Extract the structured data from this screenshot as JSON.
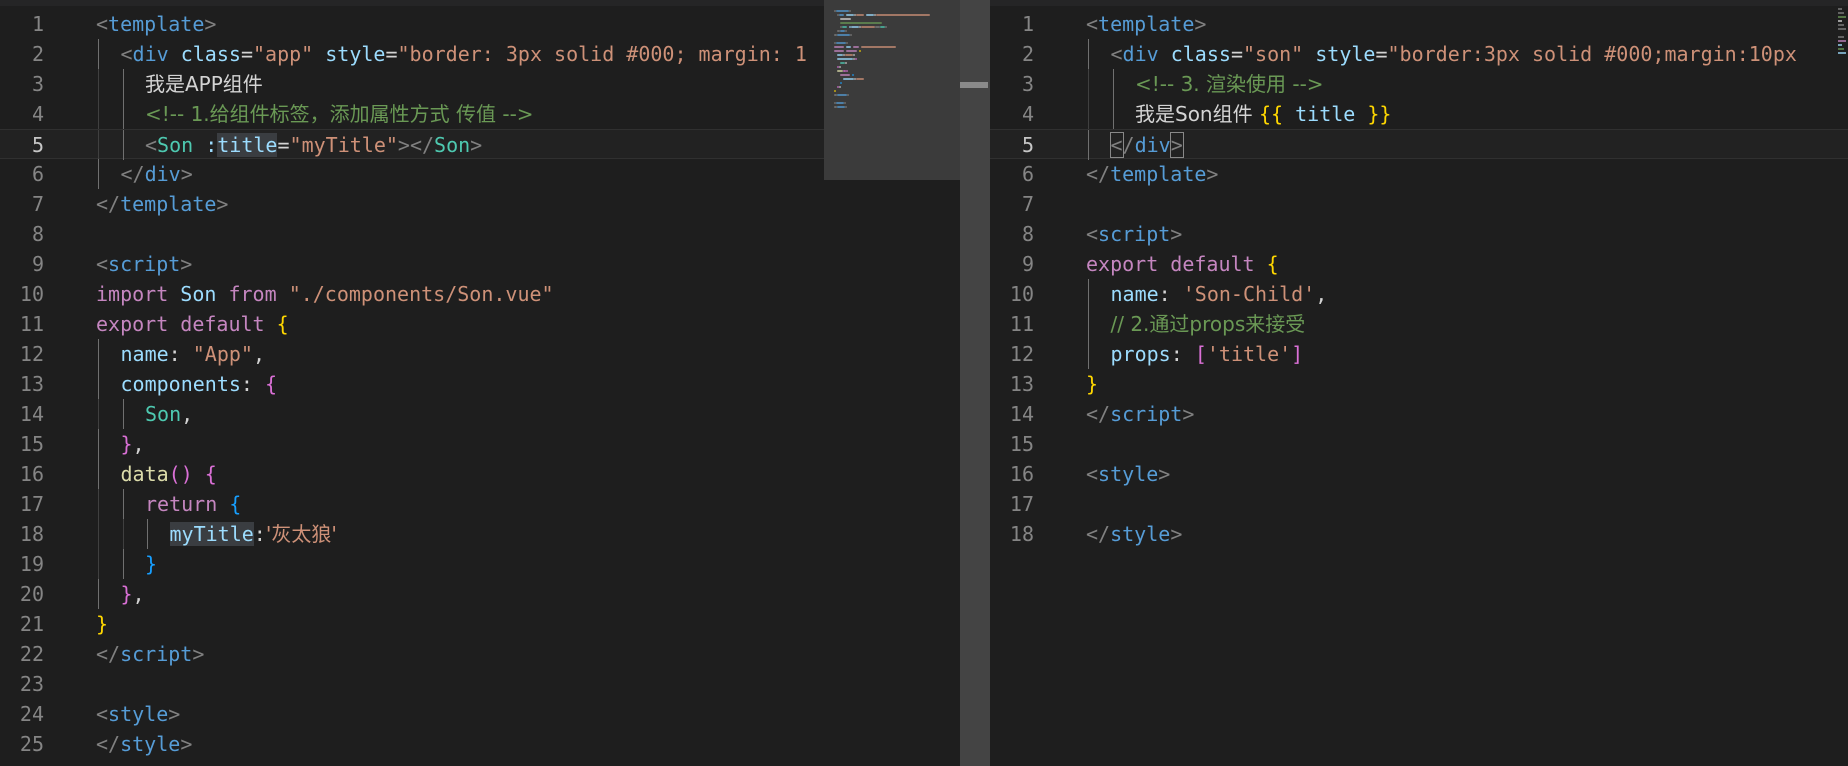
{
  "colors": {
    "background": "#1e1e1e",
    "tag": "#569cd6",
    "punct": "#808080",
    "attr": "#9cdcfe",
    "string": "#ce9178",
    "comment": "#6a9955",
    "keyword": "#c586c0",
    "component": "#4ec9b0",
    "function": "#dcdcaa",
    "bracket_gold": "#ffd700",
    "bracket_pink": "#da70d6",
    "bracket_blue": "#179fff",
    "text": "#d4d4d4"
  },
  "left_editor": {
    "active_line": 5,
    "lines": [
      {
        "n": "1",
        "indent": 0,
        "toks": [
          [
            "<",
            "punct"
          ],
          [
            "template",
            "tag"
          ],
          [
            ">",
            "punct"
          ]
        ]
      },
      {
        "n": "2",
        "indent": 1,
        "toks": [
          [
            "<",
            "punct"
          ],
          [
            "div",
            "tag"
          ],
          [
            " ",
            "text"
          ],
          [
            "class",
            "attr"
          ],
          [
            "=",
            "text"
          ],
          [
            "\"app\"",
            "string"
          ],
          [
            " ",
            "text"
          ],
          [
            "style",
            "attr"
          ],
          [
            "=",
            "text"
          ],
          [
            "\"border: 3px solid #000; margin: 1",
            "string"
          ]
        ]
      },
      {
        "n": "3",
        "indent": 2,
        "toks": [
          [
            "我是APP组件",
            "text"
          ]
        ]
      },
      {
        "n": "4",
        "indent": 2,
        "toks": [
          [
            "<!-- 1.给组件标签，添加属性方式 传值 -->",
            "comment"
          ]
        ]
      },
      {
        "n": "5",
        "indent": 2,
        "toks": [
          [
            "<",
            "punct"
          ],
          [
            "Son",
            "component"
          ],
          [
            " ",
            "text"
          ],
          [
            ":",
            "attr"
          ],
          [
            "title",
            "attr",
            "hl"
          ],
          [
            "=",
            "text"
          ],
          [
            "\"myTitle\"",
            "string"
          ],
          [
            "></",
            "punct"
          ],
          [
            "Son",
            "component"
          ],
          [
            ">",
            "punct"
          ]
        ]
      },
      {
        "n": "6",
        "indent": 1,
        "toks": [
          [
            "</",
            "punct"
          ],
          [
            "div",
            "tag"
          ],
          [
            ">",
            "punct"
          ]
        ]
      },
      {
        "n": "7",
        "indent": 0,
        "toks": [
          [
            "</",
            "punct"
          ],
          [
            "template",
            "tag"
          ],
          [
            ">",
            "punct"
          ]
        ]
      },
      {
        "n": "8",
        "indent": 0,
        "toks": []
      },
      {
        "n": "9",
        "indent": 0,
        "toks": [
          [
            "<",
            "punct"
          ],
          [
            "script",
            "tag"
          ],
          [
            ">",
            "punct"
          ]
        ]
      },
      {
        "n": "10",
        "indent": 0,
        "toks": [
          [
            "import",
            "keyword"
          ],
          [
            " ",
            "text"
          ],
          [
            "Son",
            "attr"
          ],
          [
            " ",
            "text"
          ],
          [
            "from",
            "keyword"
          ],
          [
            " ",
            "text"
          ],
          [
            "\"./components/Son.vue\"",
            "string"
          ]
        ]
      },
      {
        "n": "11",
        "indent": 0,
        "toks": [
          [
            "export",
            "keyword"
          ],
          [
            " ",
            "text"
          ],
          [
            "default",
            "keyword"
          ],
          [
            " ",
            "text"
          ],
          [
            "{",
            "bracket_gold"
          ]
        ]
      },
      {
        "n": "12",
        "indent": 1,
        "toks": [
          [
            "name",
            "attr"
          ],
          [
            ": ",
            "text"
          ],
          [
            "\"App\"",
            "string"
          ],
          [
            ",",
            "text"
          ]
        ]
      },
      {
        "n": "13",
        "indent": 1,
        "toks": [
          [
            "components",
            "attr"
          ],
          [
            ": ",
            "text"
          ],
          [
            "{",
            "bracket_pink"
          ]
        ]
      },
      {
        "n": "14",
        "indent": 2,
        "toks": [
          [
            "Son",
            "component"
          ],
          [
            ",",
            "text"
          ]
        ]
      },
      {
        "n": "15",
        "indent": 1,
        "toks": [
          [
            "}",
            "bracket_pink"
          ],
          [
            ",",
            "text"
          ]
        ]
      },
      {
        "n": "16",
        "indent": 1,
        "toks": [
          [
            "data",
            "function"
          ],
          [
            "() ",
            "bracket_pink"
          ],
          [
            "{",
            "bracket_pink"
          ]
        ]
      },
      {
        "n": "17",
        "indent": 2,
        "toks": [
          [
            "return",
            "keyword"
          ],
          [
            " ",
            "text"
          ],
          [
            "{",
            "bracket_blue"
          ]
        ]
      },
      {
        "n": "18",
        "indent": 3,
        "toks": [
          [
            "myTitle",
            "attr",
            "hl"
          ],
          [
            ":",
            "text"
          ],
          [
            "'灰太狼'",
            "string"
          ]
        ]
      },
      {
        "n": "19",
        "indent": 2,
        "toks": [
          [
            "}",
            "bracket_blue"
          ]
        ]
      },
      {
        "n": "20",
        "indent": 1,
        "toks": [
          [
            "}",
            "bracket_pink"
          ],
          [
            ",",
            "text"
          ]
        ]
      },
      {
        "n": "21",
        "indent": 0,
        "toks": [
          [
            "}",
            "bracket_gold"
          ]
        ]
      },
      {
        "n": "22",
        "indent": 0,
        "toks": [
          [
            "</",
            "punct"
          ],
          [
            "script",
            "tag"
          ],
          [
            ">",
            "punct"
          ]
        ]
      },
      {
        "n": "23",
        "indent": 0,
        "toks": []
      },
      {
        "n": "24",
        "indent": 0,
        "toks": [
          [
            "<",
            "punct"
          ],
          [
            "style",
            "tag"
          ],
          [
            ">",
            "punct"
          ]
        ]
      },
      {
        "n": "25",
        "indent": 0,
        "toks": [
          [
            "</",
            "punct"
          ],
          [
            "style",
            "tag"
          ],
          [
            ">",
            "punct"
          ]
        ]
      }
    ]
  },
  "right_editor": {
    "active_line": 5,
    "lines": [
      {
        "n": "1",
        "indent": 0,
        "toks": [
          [
            "<",
            "punct"
          ],
          [
            "template",
            "tag"
          ],
          [
            ">",
            "punct"
          ]
        ]
      },
      {
        "n": "2",
        "indent": 1,
        "toks": [
          [
            "<",
            "punct"
          ],
          [
            "div",
            "tag"
          ],
          [
            " ",
            "text"
          ],
          [
            "class",
            "attr"
          ],
          [
            "=",
            "text"
          ],
          [
            "\"son\"",
            "string"
          ],
          [
            " ",
            "text"
          ],
          [
            "style",
            "attr"
          ],
          [
            "=",
            "text"
          ],
          [
            "\"border:3px solid #000;margin:10px",
            "string"
          ]
        ]
      },
      {
        "n": "3",
        "indent": 2,
        "toks": [
          [
            "<!-- 3. 渲染使用 -->",
            "comment"
          ]
        ]
      },
      {
        "n": "4",
        "indent": 2,
        "toks": [
          [
            "我是Son组件 ",
            "text"
          ],
          [
            "{{",
            "bracket_gold"
          ],
          [
            " ",
            "text"
          ],
          [
            "title",
            "attr"
          ],
          [
            " ",
            "text"
          ],
          [
            "}}",
            "bracket_gold"
          ]
        ]
      },
      {
        "n": "5",
        "indent": 1,
        "toks": [
          [
            "<",
            "punct",
            "bm"
          ],
          [
            "/",
            "punct"
          ],
          [
            "div",
            "tag"
          ],
          [
            ">",
            "punct",
            "bm"
          ]
        ]
      },
      {
        "n": "6",
        "indent": 0,
        "toks": [
          [
            "</",
            "punct"
          ],
          [
            "template",
            "tag"
          ],
          [
            ">",
            "punct"
          ]
        ]
      },
      {
        "n": "7",
        "indent": 0,
        "toks": []
      },
      {
        "n": "8",
        "indent": 0,
        "toks": [
          [
            "<",
            "punct"
          ],
          [
            "script",
            "tag"
          ],
          [
            ">",
            "punct"
          ]
        ]
      },
      {
        "n": "9",
        "indent": 0,
        "toks": [
          [
            "export",
            "keyword"
          ],
          [
            " ",
            "text"
          ],
          [
            "default",
            "keyword"
          ],
          [
            " ",
            "text"
          ],
          [
            "{",
            "bracket_gold"
          ]
        ]
      },
      {
        "n": "10",
        "indent": 1,
        "toks": [
          [
            "name",
            "attr"
          ],
          [
            ": ",
            "text"
          ],
          [
            "'Son-Child'",
            "string"
          ],
          [
            ",",
            "text"
          ]
        ]
      },
      {
        "n": "11",
        "indent": 1,
        "toks": [
          [
            "// 2.通过props来接受",
            "comment"
          ]
        ]
      },
      {
        "n": "12",
        "indent": 1,
        "toks": [
          [
            "props",
            "attr"
          ],
          [
            ": ",
            "text"
          ],
          [
            "[",
            "bracket_pink"
          ],
          [
            "'title'",
            "string"
          ],
          [
            "]",
            "bracket_pink"
          ]
        ]
      },
      {
        "n": "13",
        "indent": 0,
        "toks": [
          [
            "}",
            "bracket_gold"
          ]
        ]
      },
      {
        "n": "14",
        "indent": 0,
        "toks": [
          [
            "</",
            "punct"
          ],
          [
            "script",
            "tag"
          ],
          [
            ">",
            "punct"
          ]
        ]
      },
      {
        "n": "15",
        "indent": 0,
        "toks": []
      },
      {
        "n": "16",
        "indent": 0,
        "toks": [
          [
            "<",
            "punct"
          ],
          [
            "style",
            "tag"
          ],
          [
            ">",
            "punct"
          ]
        ]
      },
      {
        "n": "17",
        "indent": 0,
        "toks": []
      },
      {
        "n": "18",
        "indent": 0,
        "toks": [
          [
            "</",
            "punct"
          ],
          [
            "style",
            "tag"
          ],
          [
            ">",
            "punct"
          ]
        ]
      }
    ]
  }
}
